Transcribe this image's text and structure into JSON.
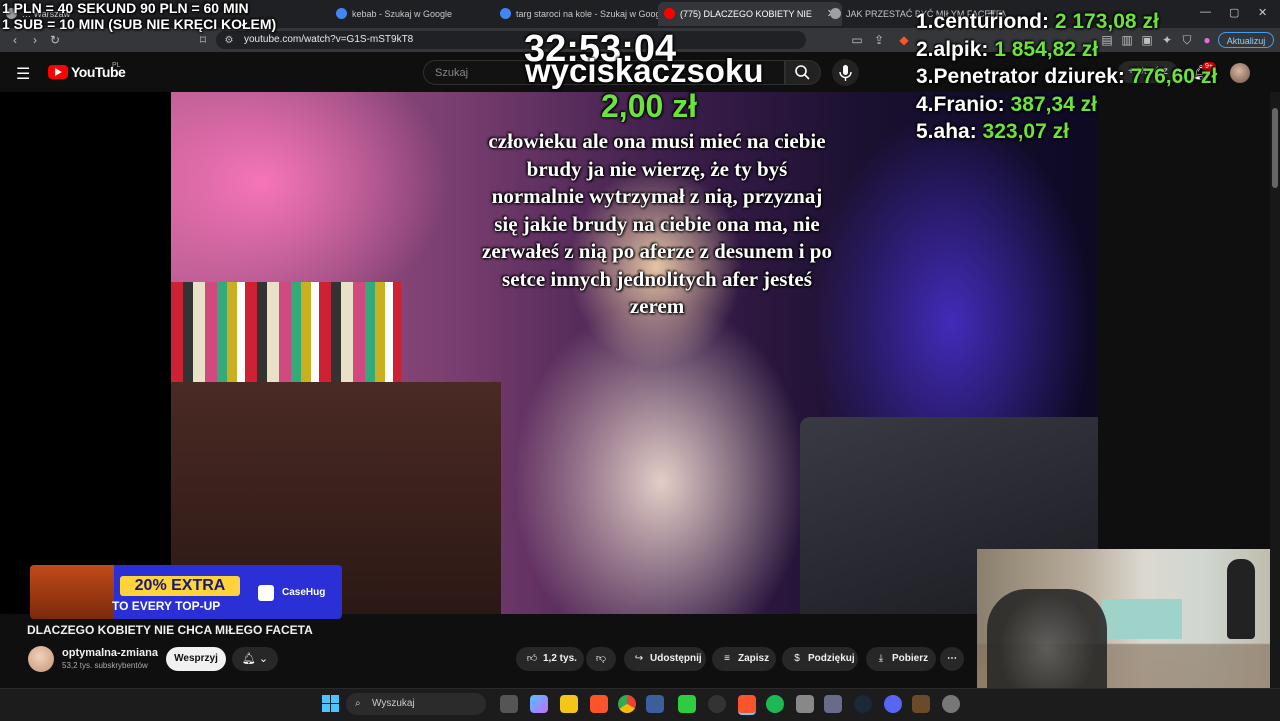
{
  "browser": {
    "tabs": [
      {
        "label": "… Warszaw",
        "active": false
      },
      {
        "label": "kebab - Szukaj w Google",
        "active": false
      },
      {
        "label": "targ staroci na kole - Szukaj w Google",
        "active": false
      },
      {
        "label": "(775) DLACZEGO KOBIETY NIE",
        "active": true
      },
      {
        "label": "JAK PRZESTAĆ BYĆ MIŁYM FACETEM",
        "active": false
      }
    ],
    "url": "youtube.com/watch?v=G1S-mST9kT8",
    "update_label": "Aktualizuj"
  },
  "youtube": {
    "logo_text": "YouTube",
    "country": "PL",
    "search_placeholder": "Szukaj",
    "create_label": "+ Utwórz",
    "notification_count": "9+"
  },
  "overlay": {
    "rate_line_1": "1 PLN = 40 SEKUND 90 PLN = 60 MIN",
    "rate_line_2": "1 SUB = 10 MIN (SUB NIE KRĘCI KOŁEM)",
    "timer": "32:53:04",
    "donor_name": "wyciskaczsoku",
    "donor_amount": "2,00 zł",
    "donation_message": "człowieku ale ona musi mieć na ciebie brudy ja nie wierzę, że ty byś normalnie wytrzymał z nią, przyznaj się jakie brudy na ciebie ona ma, nie zerwałeś z nią po aferze z desunem i po setce innych jednolitych afer jesteś zerem",
    "leaderboard": [
      {
        "rank": "1.",
        "name": "centuriond:",
        "amount": "2 173,08 zł"
      },
      {
        "rank": "2.",
        "name": "alpik:",
        "amount": "1 854,82 zł"
      },
      {
        "rank": "3.",
        "name": "Penetrator dziurek:",
        "amount": "776,60 zł"
      },
      {
        "rank": "4.",
        "name": "Franio:",
        "amount": "387,34 zł"
      },
      {
        "rank": "5.",
        "name": "aha:",
        "amount": "323,07 zł"
      }
    ]
  },
  "ad": {
    "headline": "20% EXTRA",
    "subline": "TO EVERY TOP-UP",
    "brand": "CaseHug"
  },
  "video": {
    "title": "DLACZEGO KOBIETY NIE CHCA MIŁEGO FACETA",
    "channel_name": "optymalna-zmiana",
    "channel_subs": "53,2 tys. subskrybentów",
    "support_label": "Wesprzyj",
    "actions": {
      "likes": "1,2 tys.",
      "share": "Udostępnij",
      "save": "Zapisz",
      "thanks": "Podziękuj",
      "download": "Pobierz"
    }
  },
  "taskbar": {
    "search_placeholder": "Wyszukaj"
  },
  "colors": {
    "accent_green": "#6be33a",
    "youtube_red": "#ff0000",
    "ad_blue": "#2a2fd6",
    "ad_yellow": "#ffd43b"
  }
}
